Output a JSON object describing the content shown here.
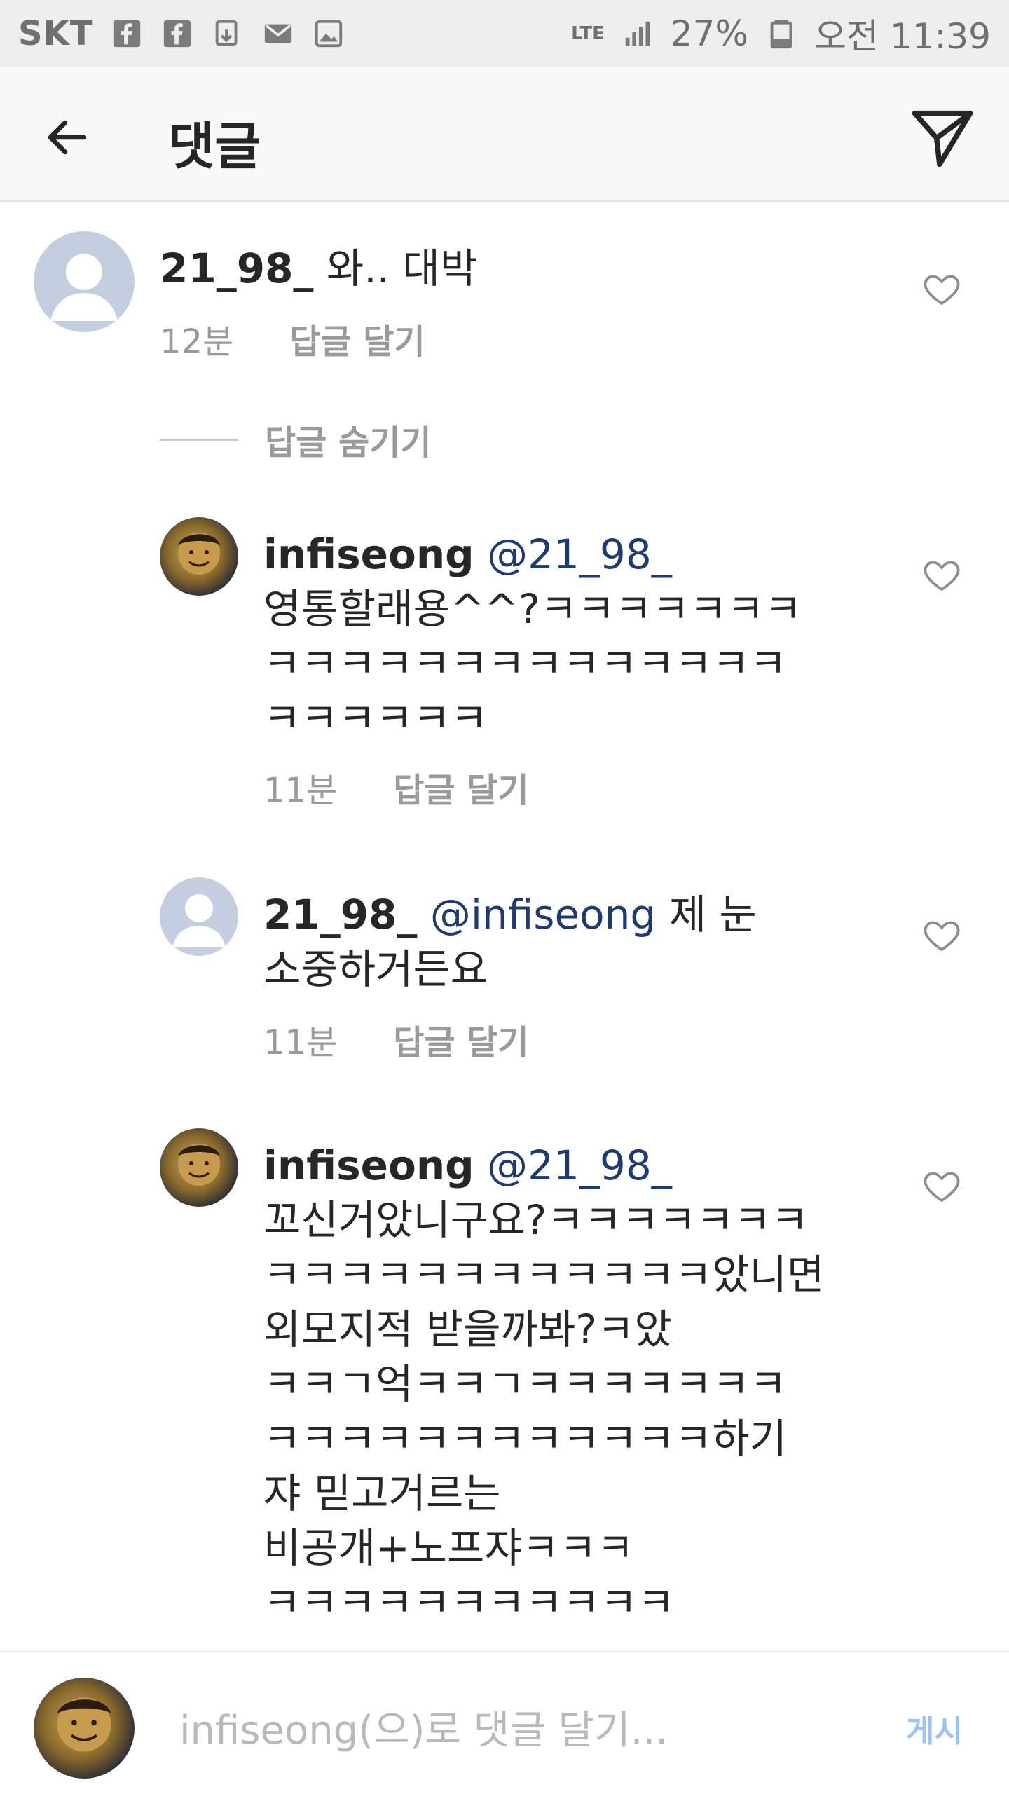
{
  "status": {
    "carrier": "SKT",
    "lte": "LTE",
    "battery": "27%",
    "time": "오전 11:39"
  },
  "header": {
    "title": "댓글"
  },
  "comments": [
    {
      "username": "21_98_",
      "text": "와.. 대박",
      "time": "12분",
      "reply": "답글 달기"
    }
  ],
  "hide_replies": "답글 숨기기",
  "replies": [
    {
      "username": "infiseong",
      "mention": "@21_98_",
      "lines": [
        "영통할래용^^?ㅋㅋㅋㅋㅋㅋㅋ",
        "ㅋㅋㅋㅋㅋㅋㅋㅋㅋㅋㅋㅋㅋㅋ",
        "ㅋㅋㅋㅋㅋㅋ"
      ],
      "time": "11분",
      "reply": "답글 달기"
    },
    {
      "username": "21_98_",
      "mention": "@infiseong",
      "lines": [
        "제 눈",
        "소중하거든요"
      ],
      "time": "11분",
      "reply": "답글 달기"
    },
    {
      "username": "infiseong",
      "mention": "@21_98_",
      "lines": [
        "꼬신거았니구요?ㅋㅋㅋㅋㅋㅋㅋ",
        "ㅋㅋㅋㅋㅋㅋㅋㅋㅋㅋㅋㅋ았니면",
        "외모지적 받을까봐?ㅋ았",
        "ㅋㅋㄱ억ㅋㅋㄱㅋㅋㅋㅋㅋㅋㅋ",
        "ㅋㅋㅋㅋㅋㅋㅋㅋㅋㅋㅋㅋ하기",
        "쟈 믿고거르는",
        "비공개+노프쟈ㅋㅋㅋ",
        "ㅋㅋㅋㅋㅋㅋㅋㅋㅋㅋㅋ"
      ]
    }
  ],
  "composer": {
    "placeholder": "infiseong(으)로 댓글 달기...",
    "post": "게시"
  },
  "icons": {
    "back": "arrow-left-icon",
    "send": "paper-plane-icon",
    "heart": "heart-outline-icon"
  }
}
